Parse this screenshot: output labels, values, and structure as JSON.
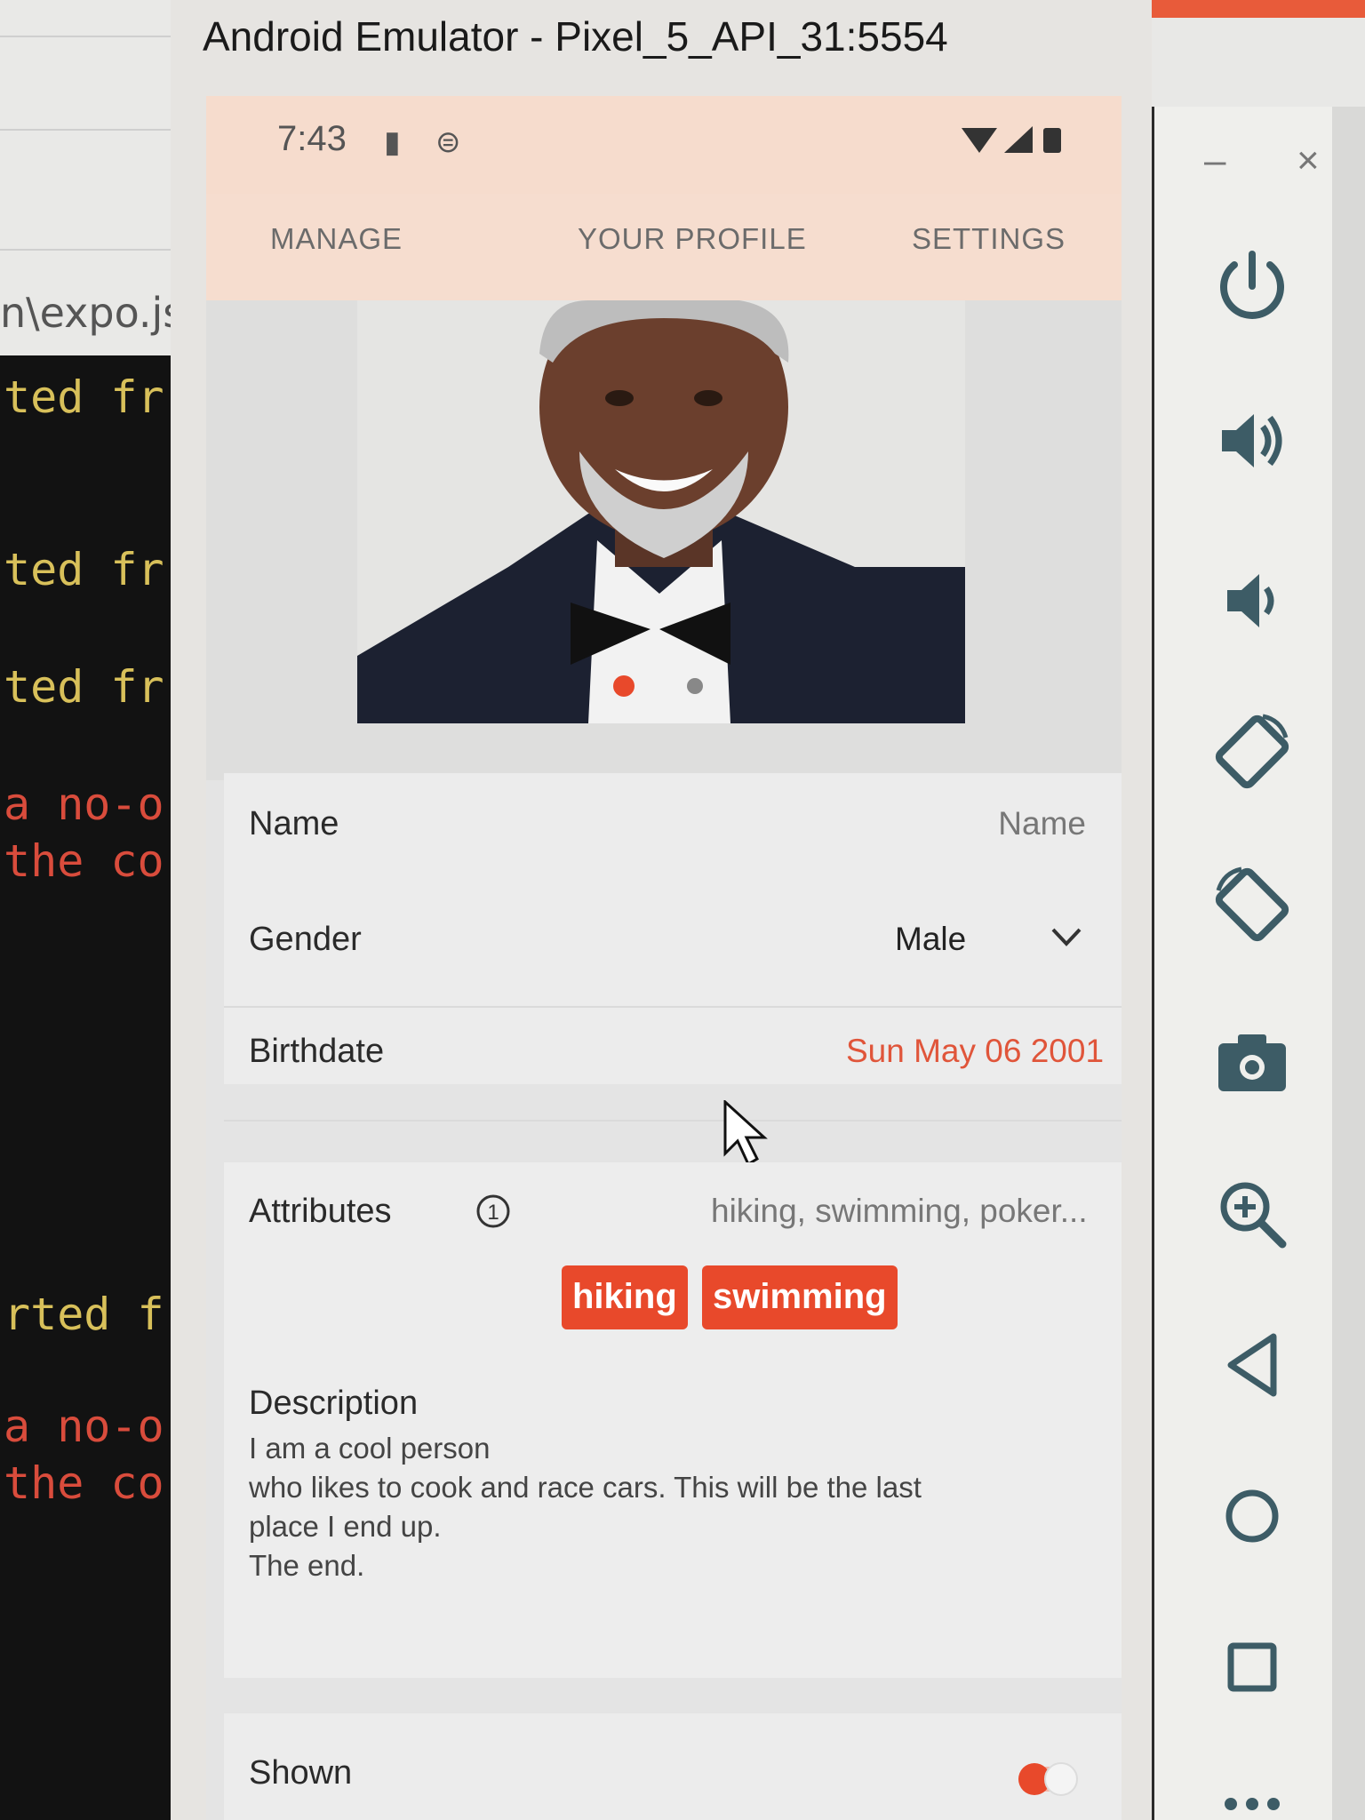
{
  "emulator": {
    "title": "Android Emulator - Pixel_5_API_31:5554",
    "window_controls": {
      "minimize": "–",
      "close": "×"
    }
  },
  "background_terminal": {
    "path_text": "n\\expo.js",
    "lines": [
      "ted fr",
      "ted fr",
      "ted fr",
      "a no-o",
      "the co",
      "rted fr",
      "a no-o",
      "the co"
    ]
  },
  "status_bar": {
    "time": "7:43"
  },
  "tabs": [
    {
      "label": "MANAGE"
    },
    {
      "label": "YOUR PROFILE"
    },
    {
      "label": "SETTINGS"
    }
  ],
  "profile": {
    "fields": {
      "name": {
        "label": "Name",
        "placeholder": "Name"
      },
      "gender": {
        "label": "Gender",
        "value": "Male"
      },
      "birthdate": {
        "label": "Birthdate",
        "value": "Sun May 06 2001"
      }
    },
    "attributes": {
      "label": "Attributes",
      "summary": "hiking, swimming, poker...",
      "chips": [
        "hiking",
        "swimming"
      ]
    },
    "description": {
      "label": "Description",
      "text": "I am a cool person\nwho likes to cook and race cars. This will be the last\nplace I end up.\nThe end."
    },
    "shown": {
      "label": "Shown",
      "enabled": true
    }
  },
  "colors": {
    "accent": "#e8492b",
    "header_bg": "#f6ddcf",
    "birthdate_text": "#e0553a"
  },
  "toolbar_icons": [
    "power-icon",
    "volume-up-icon",
    "volume-down-icon",
    "rotate-left-icon",
    "rotate-right-icon",
    "camera-icon",
    "zoom-in-icon",
    "back-icon",
    "home-icon",
    "overview-icon",
    "more-icon"
  ]
}
